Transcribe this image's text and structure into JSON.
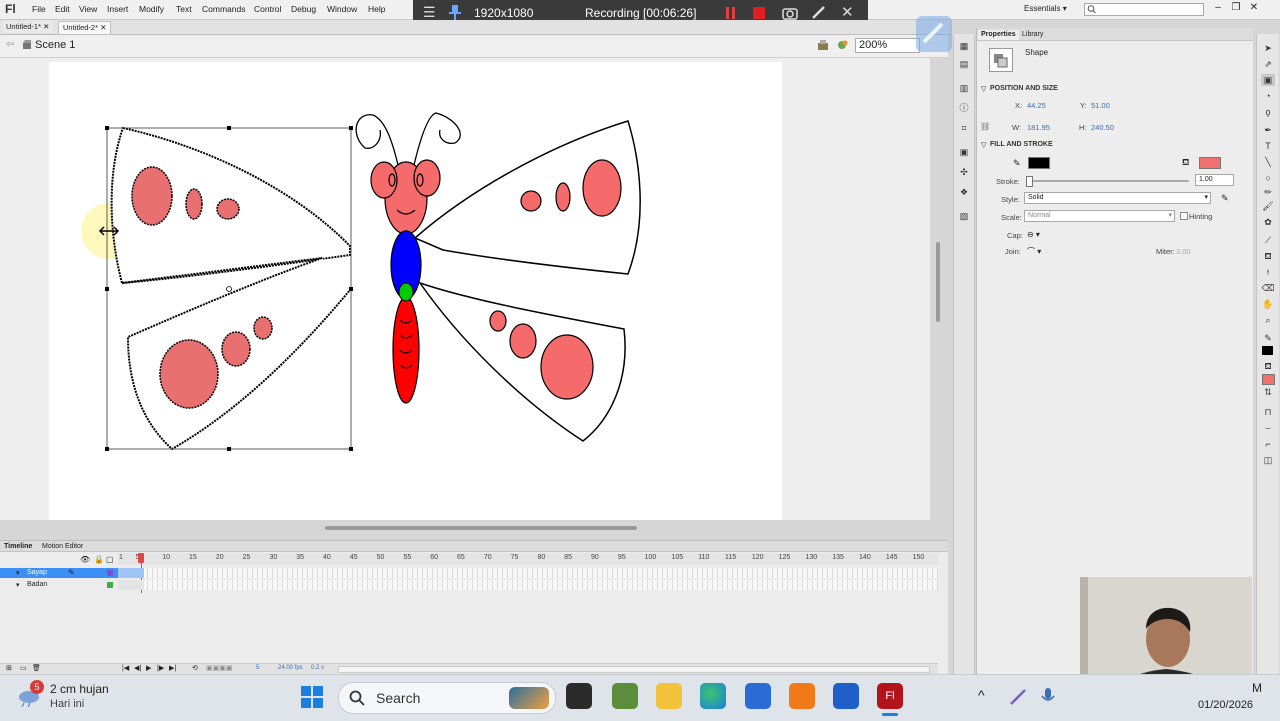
{
  "app": {
    "logo": "Fl"
  },
  "menu": [
    "File",
    "Edit",
    "View",
    "Insert",
    "Modify",
    "Text",
    "Commands",
    "Control",
    "Debug",
    "Window",
    "Help"
  ],
  "recorder": {
    "resolution": "1920x1080",
    "status": "Recording [00:06:26]"
  },
  "workspace": {
    "name": "Essentials"
  },
  "doc_tabs": [
    "Untitled-1*",
    "Untitled-2*"
  ],
  "scene": {
    "label": "Scene 1",
    "zoom": "200%"
  },
  "properties": {
    "tabs": [
      "Properties",
      "Library"
    ],
    "object_type": "Shape",
    "position_and_size": {
      "title": "POSITION AND SIZE",
      "x_label": "X:",
      "x": "44.25",
      "y_label": "Y:",
      "y": "51.00",
      "w_label": "W:",
      "w": "181.95",
      "h_label": "H:",
      "h": "240.50"
    },
    "fill_and_stroke": {
      "title": "FILL AND STROKE",
      "stroke_color": "#000000",
      "fill_color": "#f07070",
      "stroke_label": "Stroke:",
      "stroke_value": "1.00",
      "style_label": "Style:",
      "style_value": "Solid",
      "scale_label": "Scale:",
      "scale_value": "Normal",
      "hinting_label": "Hinting",
      "cap_label": "Cap:",
      "join_label": "Join:",
      "miter_label": "Miter:",
      "miter_value": "3.00"
    }
  },
  "timeline": {
    "tabs": [
      "Timeline",
      "Motion Editor"
    ],
    "frame_numbers": [
      "1",
      "5",
      "10",
      "15",
      "20",
      "25",
      "30",
      "35",
      "40",
      "45",
      "50",
      "55",
      "60",
      "65",
      "70",
      "75",
      "80",
      "85",
      "90",
      "95",
      "100",
      "105",
      "110",
      "115",
      "120",
      "125",
      "130",
      "135",
      "140",
      "145",
      "150"
    ],
    "layers": [
      {
        "name": "Sayap",
        "selected": true
      },
      {
        "name": "Badan",
        "selected": false
      }
    ],
    "footer": {
      "frame": "5",
      "fps": "24.00 fps",
      "time": "0.2 s"
    }
  },
  "taskbar": {
    "weather_badge": "5",
    "weather_title": "2 cm hujan",
    "weather_sub": "Hari ini",
    "search_label": "Search",
    "date": "01/20/2026",
    "time_suffix": "M"
  },
  "colors": {
    "wing_spot": "#f07070",
    "head": "#f56a6a",
    "thorax": "#0000ff",
    "abdomen": "#ff0000",
    "green": "#00cc00"
  }
}
